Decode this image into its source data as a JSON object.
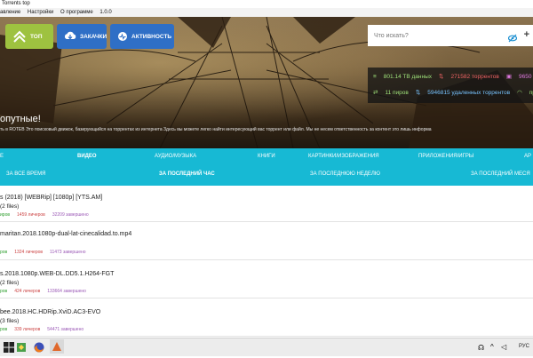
{
  "window": {
    "title": "Torrents top"
  },
  "menu": [
    "авление",
    "Настройки",
    "О программе",
    "1.0.0"
  ],
  "toolbar": {
    "top_label": "ТОП",
    "downloads_label": "ЗАКАЧКИ",
    "activity_label": "АКТИВНОСТЬ"
  },
  "search": {
    "placeholder": "Что искать?"
  },
  "stats": {
    "data_size": "801.14 TB данных",
    "torrents": "271582 торрентов",
    "files": "9650",
    "peers": "11 пиров",
    "removed": "5946815 удаленных торрентов",
    "other": "пр"
  },
  "hero": {
    "heading": "опутные!",
    "description": "ть в ROTEB Это поисковый движок, базирующийся на торрентах из интернета Здесь вы можете легко найти интересующий вас торрент или файл. Мы не несем ответственность за контент это лишь информа"
  },
  "categories": {
    "row1": [
      "Е",
      "ВИДЕО",
      "АУДИО/МУЗЫКА",
      "КНИГИ",
      "КАРТИНКИ/ИЗОБРАЖЕНИЯ",
      "ПРИЛОЖЕНИЯ/ИГРЫ",
      "АР"
    ],
    "row2": [
      "ЗА ВСЕ ВРЕМЯ",
      "ЗА ПОСЛЕДНИЙ ЧАС",
      "ЗА ПОСЛЕДНЮЮ НЕДЕЛЮ",
      "ЗА ПОСЛЕДНИЙ МЕСЯ"
    ]
  },
  "torrents": [
    {
      "title": "s (2018) [WEBRip] [1080p] [YTS.AM]",
      "files": "(2 files)",
      "peers": "иров",
      "leechers": "1459 личеров",
      "completed": "32209 завершено"
    },
    {
      "title": "maritan.2018.1080p-dual-lat-cinecalidad.to.mp4",
      "files": "",
      "peers": "ров",
      "leechers": "1324 личеров",
      "completed": "11473 завершено"
    },
    {
      "title": "s.2018.1080p.WEB-DL.DD5.1.H264-FGT",
      "files": "(2 files)",
      "peers": "ров",
      "leechers": "424 личеров",
      "completed": "133664 завершено"
    },
    {
      "title": "bee.2018.HC.HDRip.XviD.AC3-EVO",
      "files": "(3 files)",
      "peers": "ров",
      "leechers": "339 личеров",
      "completed": "54471 завершено"
    }
  ],
  "taskbar": {
    "language": "РУС"
  }
}
